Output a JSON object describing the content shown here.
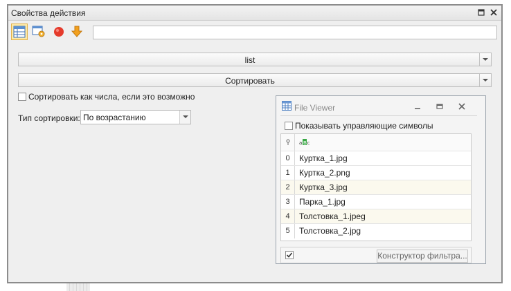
{
  "window": {
    "title": "Свойства действия"
  },
  "toolbar": {
    "input_value": ""
  },
  "list_combo": {
    "value": "list"
  },
  "action_combo": {
    "value": "Сортировать"
  },
  "sort_numbers": {
    "label": "Сортировать как числа, если это возможно",
    "checked": false
  },
  "sort_type": {
    "label": "Тип сортировки:",
    "value": "По возрастанию"
  },
  "file_viewer": {
    "title": "File Viewer",
    "show_control_chars": "Показывать управляющие символы",
    "rows": [
      {
        "index": "0",
        "name": "Куртка_1.jpg"
      },
      {
        "index": "1",
        "name": "Куртка_2.png"
      },
      {
        "index": "2",
        "name": "Куртка_3.jpg"
      },
      {
        "index": "3",
        "name": "Парка_1.jpg"
      },
      {
        "index": "4",
        "name": "Толстовка_1.jpeg"
      },
      {
        "index": "5",
        "name": "Толстовка_2.jpg"
      }
    ],
    "filter_button": "Конструктор фильтра..."
  },
  "colors": {
    "active_tool": "#fde9a7",
    "record_red": "#e53b2c",
    "arrow_orange": "#f2a01e",
    "grid_alt": "#fbf9ee"
  }
}
